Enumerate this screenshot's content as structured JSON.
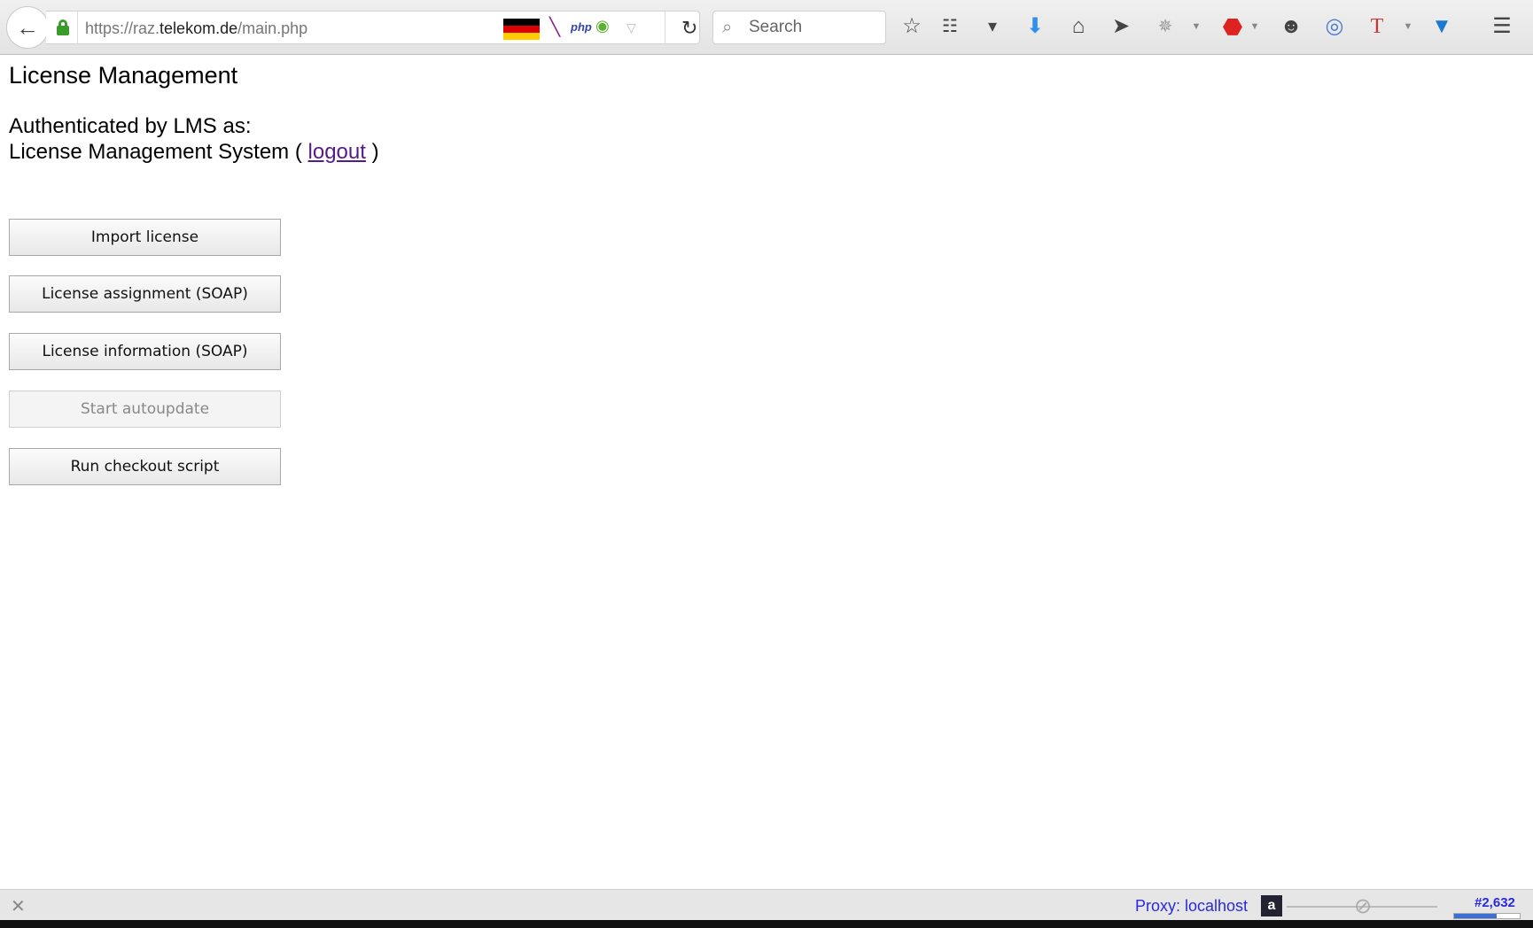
{
  "browser": {
    "url_prefix": "https://raz.",
    "url_domain": "telekom.de",
    "url_path": "/main.php",
    "search_placeholder": "Search",
    "extensions": [
      "php"
    ]
  },
  "page": {
    "title": "License Management",
    "auth_line1": "Authenticated by LMS as:",
    "auth_user": "License Management System",
    "open_paren": "(",
    "logout": "logout",
    "close_paren": ")",
    "buttons": [
      {
        "label": "Import license",
        "disabled": false
      },
      {
        "label": "License assignment (SOAP)",
        "disabled": false
      },
      {
        "label": "License information (SOAP)",
        "disabled": false
      },
      {
        "label": "Start autoupdate",
        "disabled": true
      },
      {
        "label": "Run checkout script",
        "disabled": false
      }
    ]
  },
  "statusbar": {
    "proxy": "Proxy: localhost",
    "count": "#2,632",
    "progress_percent": 65
  }
}
